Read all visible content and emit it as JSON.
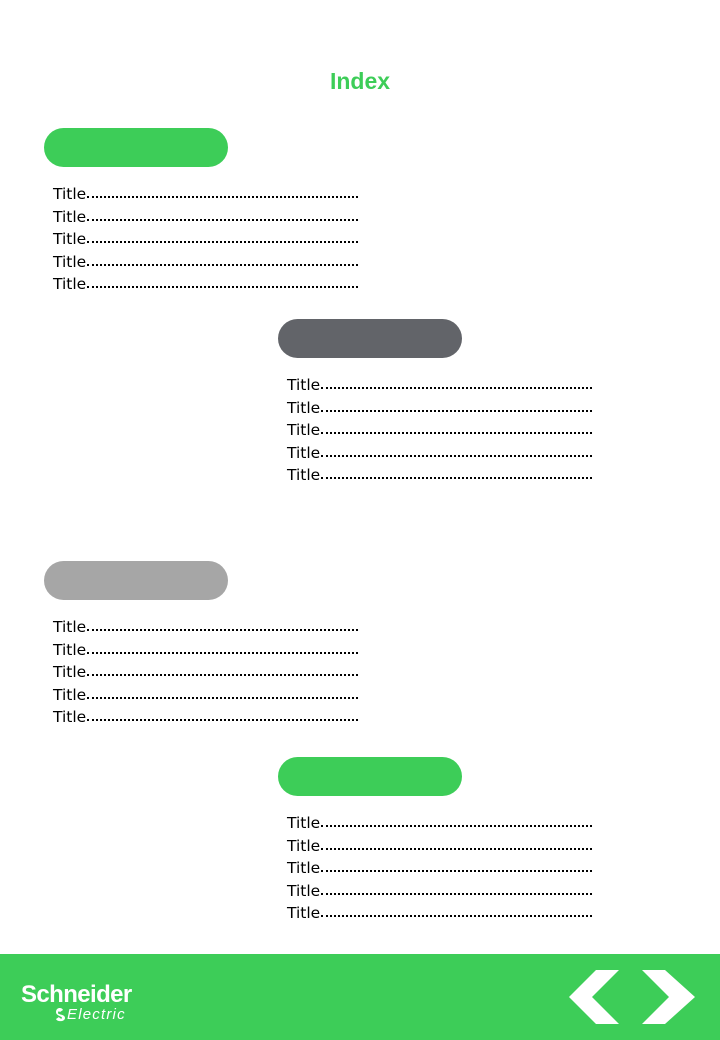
{
  "page": {
    "title": "Index"
  },
  "colors": {
    "brand_green": "#3dcd58",
    "dark_gray": "#626469",
    "light_gray": "#a6a6a6"
  },
  "sections": [
    {
      "pill_color": "green",
      "items": [
        "Title",
        "Title",
        "Title",
        "Title",
        "Title"
      ]
    },
    {
      "pill_color": "dark_gray",
      "items": [
        "Title",
        "Title",
        "Title",
        "Title",
        "Title"
      ]
    },
    {
      "pill_color": "light_gray",
      "items": [
        "Title",
        "Title",
        "Title",
        "Title",
        "Title"
      ]
    },
    {
      "pill_color": "green",
      "items": [
        "Title",
        "Title",
        "Title",
        "Title",
        "Title"
      ]
    }
  ],
  "footer": {
    "logo": {
      "name_top": "Schneider",
      "name_bottom": "Electric"
    },
    "nav": {
      "prev_icon": "chevron-left-icon",
      "next_icon": "chevron-right-icon"
    }
  }
}
